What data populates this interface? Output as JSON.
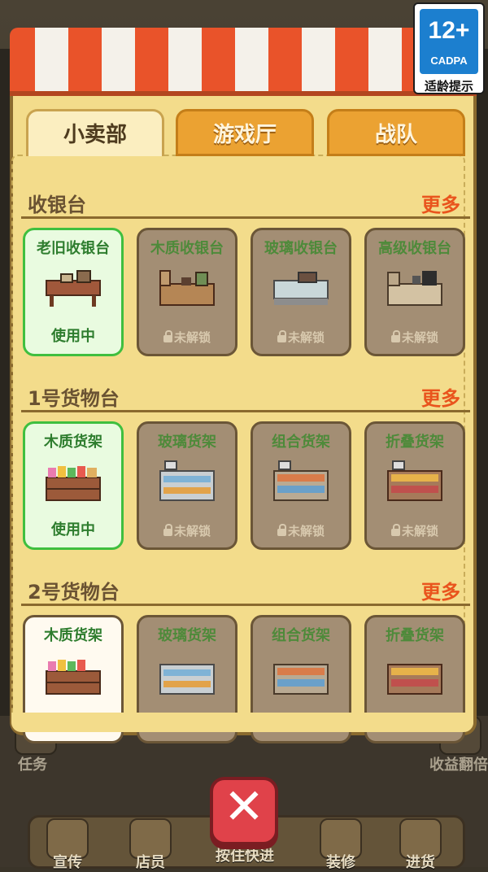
{
  "age_badge": {
    "age": "12+",
    "org": "CADPA",
    "tip": "适龄提示"
  },
  "tabs": [
    {
      "label": "小卖部",
      "active": true
    },
    {
      "label": "游戏厅",
      "active": false
    },
    {
      "label": "战队",
      "active": false
    }
  ],
  "sections": [
    {
      "title": "收银台",
      "more": "更多",
      "items": [
        {
          "name": "老旧收银台",
          "status": "使用中",
          "state": "inuse",
          "icon": "old-cashier-desk-icon"
        },
        {
          "name": "木质收银台",
          "status": "未解锁",
          "state": "locked",
          "icon": "wood-cashier-desk-icon"
        },
        {
          "name": "玻璃收银台",
          "status": "未解锁",
          "state": "locked",
          "icon": "glass-cashier-desk-icon"
        },
        {
          "name": "高级收银台",
          "status": "未解锁",
          "state": "locked",
          "icon": "premium-cashier-desk-icon"
        }
      ]
    },
    {
      "title": "1号货物台",
      "more": "更多",
      "items": [
        {
          "name": "木质货架",
          "status": "使用中",
          "state": "inuse",
          "icon": "wood-shelf-icon"
        },
        {
          "name": "玻璃货架",
          "status": "未解锁",
          "state": "locked",
          "icon": "glass-shelf-icon"
        },
        {
          "name": "组合货架",
          "status": "未解锁",
          "state": "locked",
          "icon": "combo-shelf-icon"
        },
        {
          "name": "折叠货架",
          "status": "未解锁",
          "state": "locked",
          "icon": "folding-shelf-icon"
        }
      ]
    },
    {
      "title": "2号货物台",
      "more": "更多",
      "items": [
        {
          "name": "木质货架",
          "status": "",
          "state": "white",
          "icon": "wood-shelf-icon"
        },
        {
          "name": "玻璃货架",
          "status": "",
          "state": "locked",
          "icon": "glass-shelf-icon"
        },
        {
          "name": "组合货架",
          "status": "",
          "state": "locked",
          "icon": "combo-shelf-icon"
        },
        {
          "name": "折叠货架",
          "status": "",
          "state": "locked",
          "icon": "folding-shelf-icon"
        }
      ]
    }
  ],
  "background": {
    "left_label": "任务",
    "right_label": "收益翻倍",
    "nav": [
      "宣传",
      "店员",
      "按住快进",
      "装修",
      "进货"
    ]
  },
  "close_symbol": "✕",
  "colors": {
    "accent": "#e9541d",
    "panel": "#f3dc8b",
    "active_green": "#3fbf3f",
    "close_red": "#e0424a"
  }
}
